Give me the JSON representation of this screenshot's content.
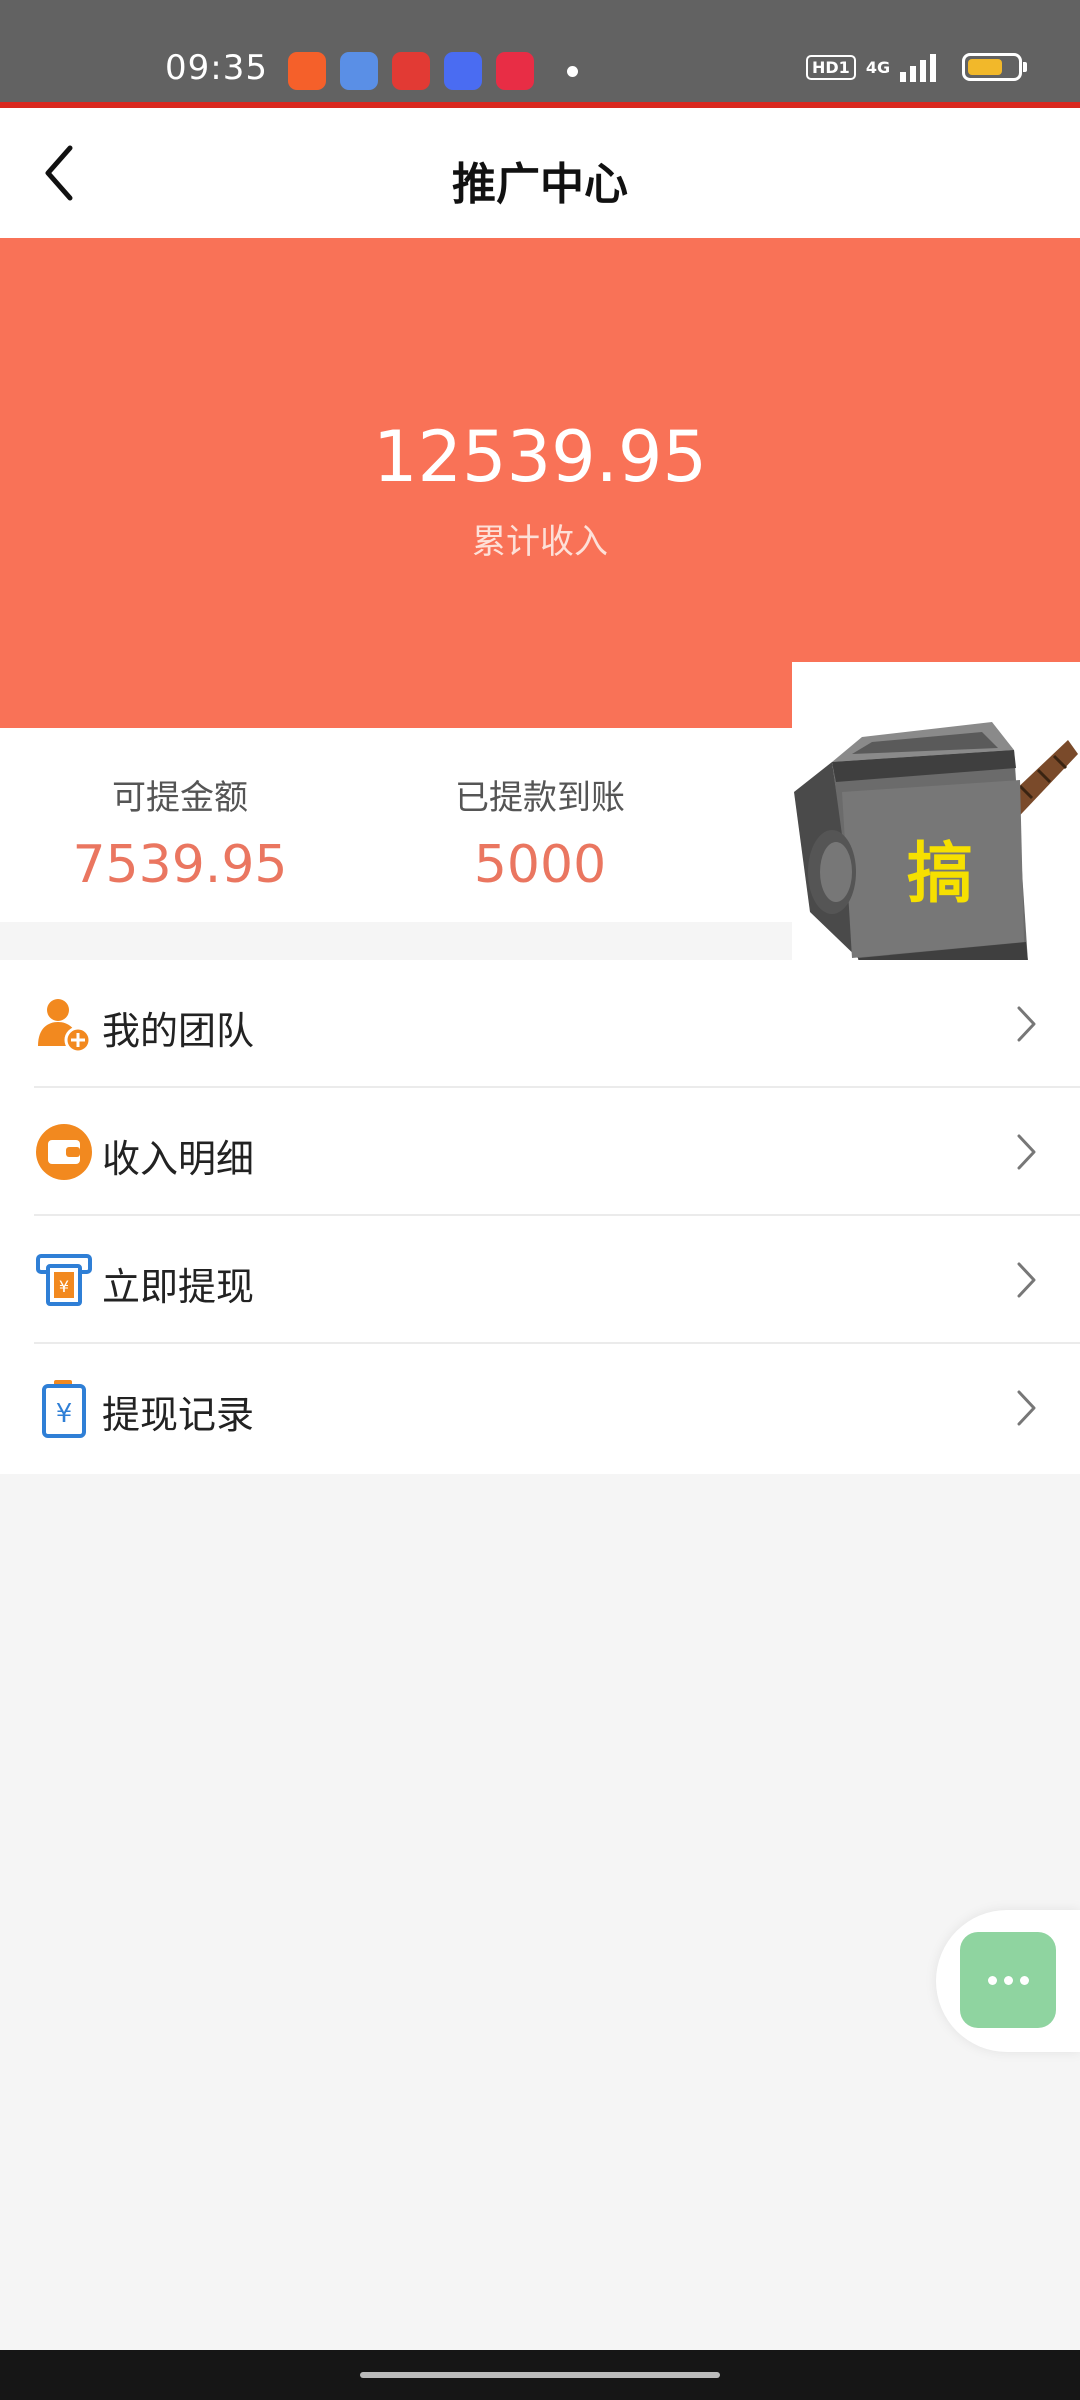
{
  "status_bar": {
    "time": "09:35",
    "app_icons": [
      {
        "name": "app-icon-1",
        "color": "#f5602a",
        "text": ""
      },
      {
        "name": "app-icon-2",
        "color": "#5a8fe6",
        "text": ""
      },
      {
        "name": "app-icon-3",
        "color": "#e23a34",
        "text": ""
      },
      {
        "name": "app-icon-4",
        "color": "#4a6cf2",
        "text": ""
      },
      {
        "name": "app-icon-5",
        "color": "#e82d45",
        "text": ""
      }
    ],
    "hd_label": "HD1",
    "network_label": "4G",
    "battery_level": 0.7
  },
  "navbar": {
    "title": "推广中心"
  },
  "hero": {
    "amount": "12539.95",
    "label": "累计收入",
    "color": "#f97257"
  },
  "stats": [
    {
      "label": "可提金额",
      "value": "7539.95"
    },
    {
      "label": "已提款到账",
      "value": "5000"
    }
  ],
  "sticker": {
    "char": "搞"
  },
  "menu": [
    {
      "label": "我的团队",
      "icon": "team-add-icon"
    },
    {
      "label": "收入明细",
      "icon": "wallet-icon"
    },
    {
      "label": "立即提现",
      "icon": "withdraw-icon"
    },
    {
      "label": "提现记录",
      "icon": "withdraw-record-icon"
    }
  ],
  "colors": {
    "accent": "#f97257",
    "stat_value": "#ea7660",
    "float_button": "#8fd4a0"
  }
}
